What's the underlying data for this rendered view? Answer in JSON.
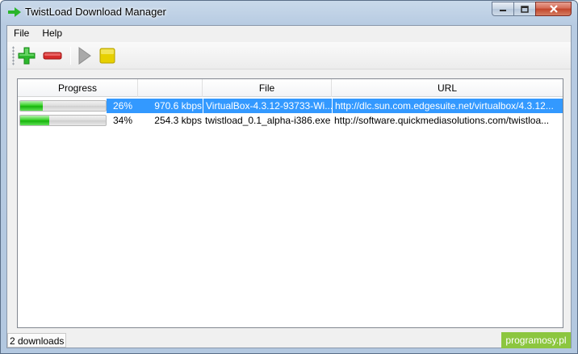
{
  "window": {
    "title": "TwistLoad Download Manager",
    "caption_close_glyph": "✕"
  },
  "menu": {
    "items": [
      {
        "label": "File"
      },
      {
        "label": "Help"
      }
    ]
  },
  "toolbar": {
    "buttons": [
      {
        "icon": "add-icon",
        "color": "#2db82d"
      },
      {
        "icon": "remove-icon",
        "color": "#d62b2b"
      },
      {
        "icon": "play-icon",
        "color": "#a9a9a9"
      },
      {
        "icon": "stop-icon",
        "color": "#e7d000"
      }
    ]
  },
  "table": {
    "columns": [
      {
        "label": "Progress"
      },
      {
        "label": ""
      },
      {
        "label": "File"
      },
      {
        "label": "URL"
      }
    ],
    "rows": [
      {
        "progress": 0.26,
        "progress_label": "26%",
        "speed": "970.6 kbps",
        "file": "VirtualBox-4.3.12-93733-Wi...",
        "url": "http://dlc.sun.com.edgesuite.net/virtualbox/4.3.12...",
        "selected": true
      },
      {
        "progress": 0.34,
        "progress_label": "34%",
        "speed": "254.3 kbps",
        "file": "twistload_0.1_alpha-i386.exe",
        "url": "http://software.quickmediasolutions.com/twistloa...",
        "selected": false
      }
    ]
  },
  "status": {
    "text": "2 downloads"
  },
  "watermark": "programosy.pl",
  "colors": {
    "selection": "#3399ff",
    "progress_fill": "#17b30c",
    "watermark_bg": "#8cc63f"
  }
}
